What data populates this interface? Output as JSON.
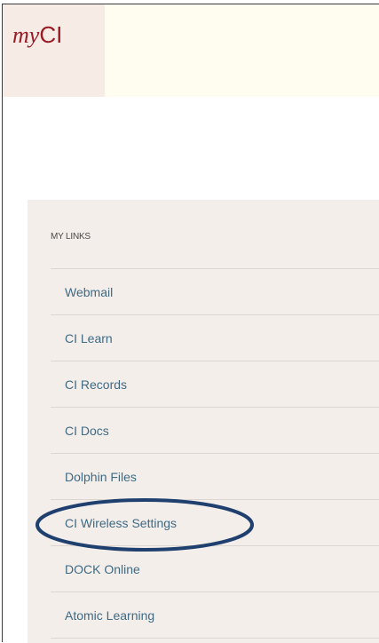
{
  "brand": {
    "prefix": "my",
    "name": "CI",
    "color": "#9a1b26"
  },
  "links": {
    "heading": "MY LINKS",
    "items": [
      {
        "label": "Webmail"
      },
      {
        "label": "CI Learn"
      },
      {
        "label": "CI Records"
      },
      {
        "label": "CI Docs"
      },
      {
        "label": "Dolphin Files"
      },
      {
        "label": "CI Wireless Settings"
      },
      {
        "label": "DOCK Online"
      },
      {
        "label": "Atomic Learning"
      }
    ],
    "link_color": "#3f6a84",
    "highlighted_item": "CI Wireless Settings",
    "highlight_color": "#1f3f6e"
  }
}
